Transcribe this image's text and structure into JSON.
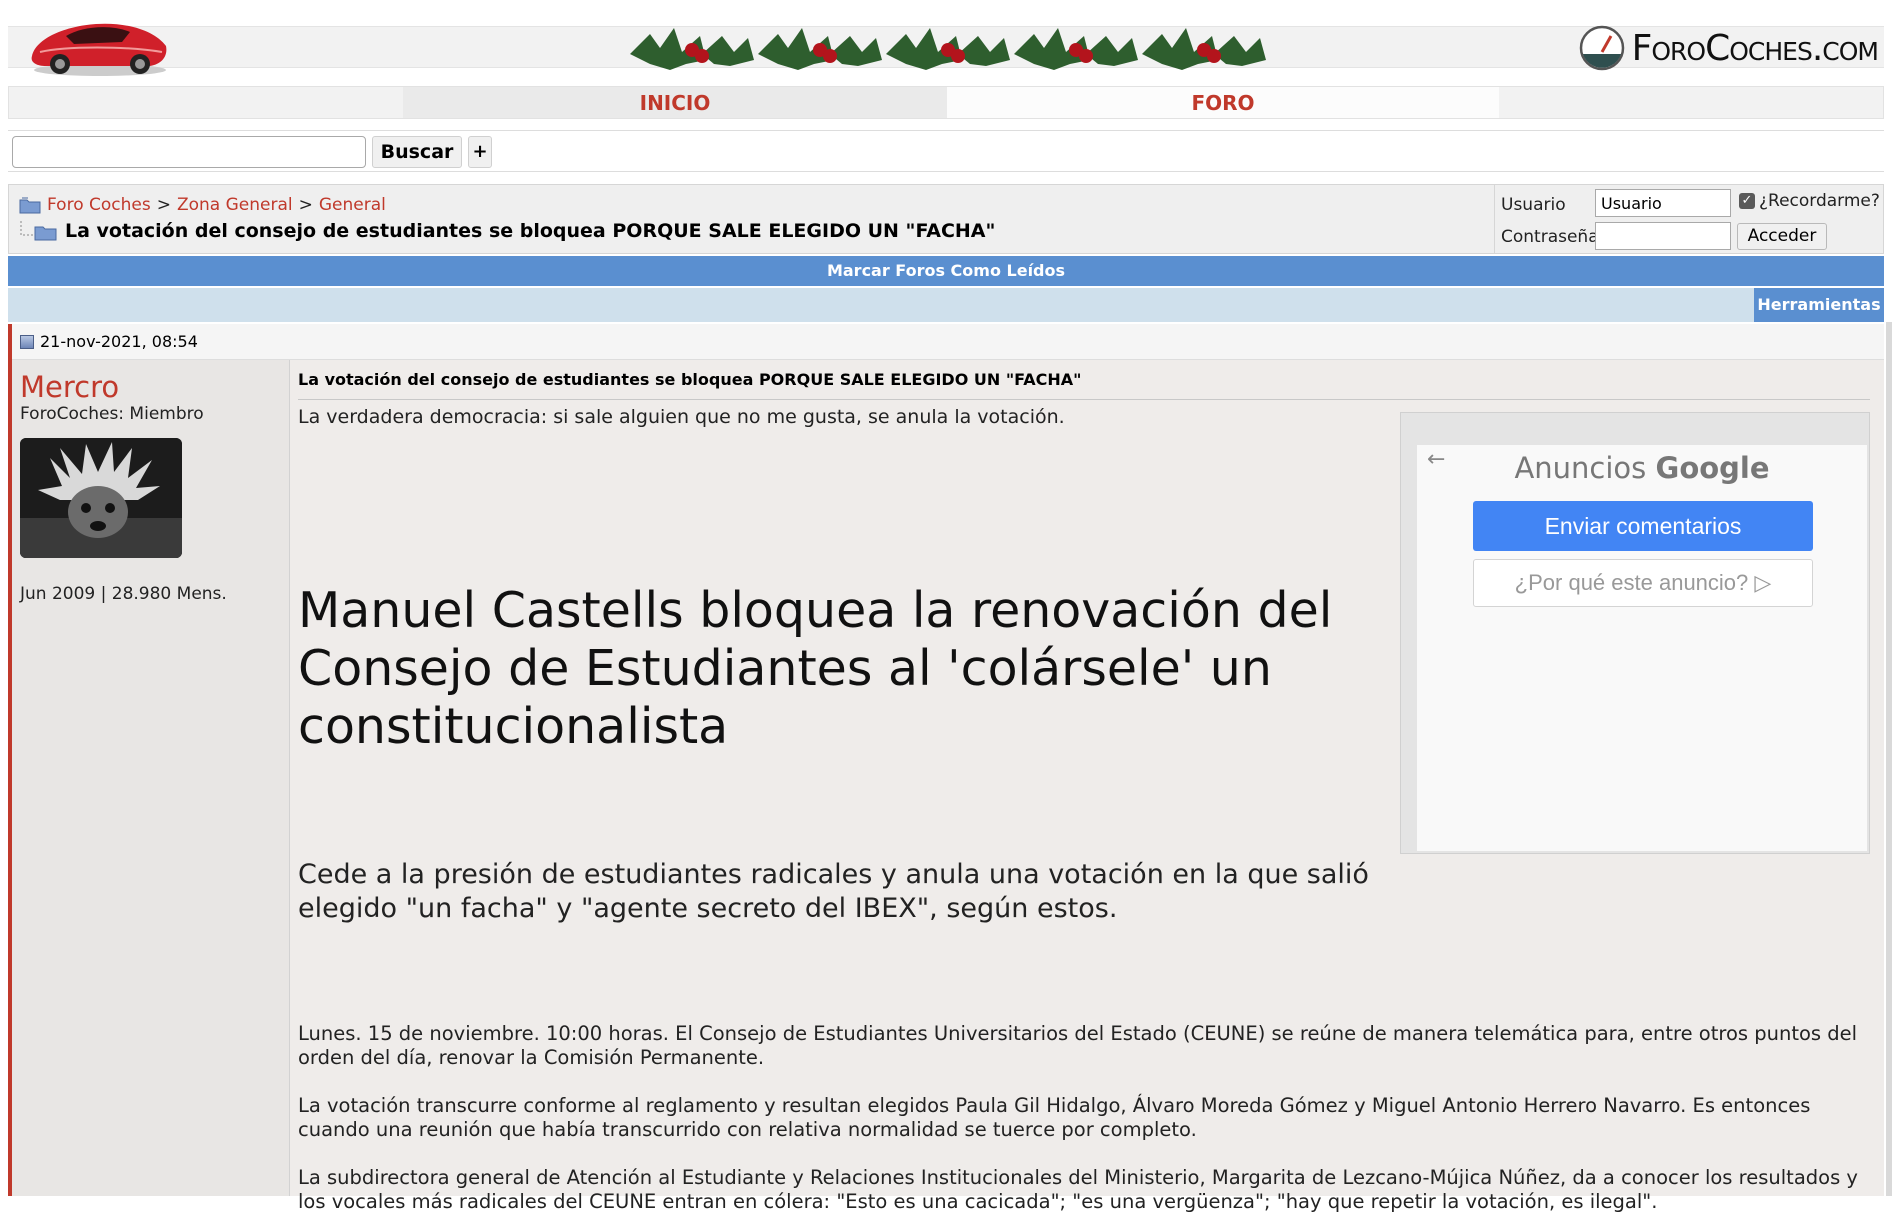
{
  "brand": {
    "name": "ForoCoches.com"
  },
  "nav": {
    "inicio": "INICIO",
    "foro": "FORO"
  },
  "search": {
    "button": "Buscar",
    "plus": "+"
  },
  "breadcrumb": {
    "items": [
      "Foro Coches",
      "Zona General",
      "General"
    ],
    "separator": ">",
    "thread_title": "La votación del consejo de estudiantes se bloquea PORQUE SALE ELEGIDO UN \"FACHA\""
  },
  "login": {
    "user_label": "Usuario",
    "user_value": "Usuario",
    "pass_label": "Contraseña",
    "remember": "¿Recordarme?",
    "submit": "Acceder"
  },
  "bars": {
    "mark_read": "Marcar Foros Como Leídos",
    "tools": "Herramientas"
  },
  "post": {
    "date": "21-nov-2021, 08:54",
    "author": "Mercro",
    "author_title": "ForoCoches: Miembro",
    "author_stats": "Jun 2009 | 28.980 Mens.",
    "title": "La votación del consejo de estudiantes se bloquea PORQUE SALE ELEGIDO UN \"FACHA\"",
    "intro": "La verdadera democracia: si sale alguien que no me gusta, se anula la votación.",
    "headline": "Manuel Castells bloquea la renovación del Consejo de Estudiantes al 'colársele' un constitucionalista",
    "subhead": "Cede a la presión de estudiantes radicales y anula una votación en la que salió elegido \"un facha\" y \"agente secreto del IBEX\", según estos.",
    "paragraphs": [
      "Lunes. 15 de noviembre. 10:00 horas. El Consejo de Estudiantes Universitarios del Estado (CEUNE) se reúne de manera telemática para, entre otros puntos del orden del día, renovar la Comisión Permanente.",
      "La votación transcurre conforme al reglamento y resultan elegidos Paula Gil Hidalgo, Álvaro Moreda Gómez y Miguel Antonio Herrero Navarro. Es entonces cuando una reunión que había transcurrido con relativa normalidad se tuerce por completo.",
      "La subdirectora general de Atención al Estudiante y Relaciones Institucionales del Ministerio, Margarita de Lezcano-Mújica Núñez, da a conocer los resultados y los vocales más radicales del CEUNE entran en cólera: \"Esto es una cacicada\"; \"es una vergüenza\"; \"hay que repetir la votación, es ilegal\"."
    ]
  },
  "ad": {
    "title_prefix": "Anuncios",
    "title_brand": "Google",
    "feedback": "Enviar comentarios",
    "why": "¿Por qué este anuncio? ▷"
  },
  "colors": {
    "accent_red": "#c0392b",
    "blue_bar": "#5a8fd0",
    "google_blue": "#4285f4"
  }
}
